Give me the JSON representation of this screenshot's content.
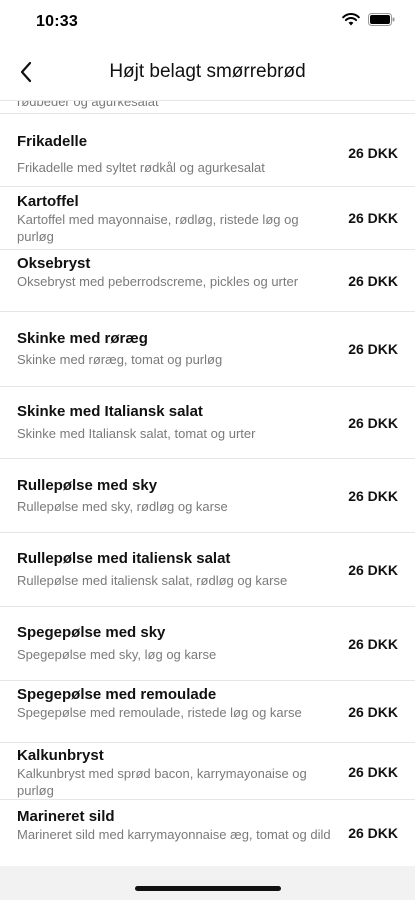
{
  "status_bar": {
    "time": "10:33"
  },
  "nav": {
    "title": "Højt belagt smørrebrød"
  },
  "list": {
    "partial_top_desc": "rødbeder og agurkesalat",
    "items": [
      {
        "name": "Frikadelle",
        "description": "Frikadelle med syltet rødkål og agurkesalat",
        "price": "26 DKK"
      },
      {
        "name": "Kartoffel",
        "description": "Kartoffel med mayonnaise, rødløg, ristede løg og purløg",
        "price": "26 DKK"
      },
      {
        "name": "Oksebryst",
        "description": "Oksebryst med peberrodscreme, pickles og urter",
        "price": "26 DKK"
      },
      {
        "name": "Skinke med røræg",
        "description": "Skinke med røræg, tomat og purløg",
        "price": "26 DKK"
      },
      {
        "name": "Skinke med Italiansk salat",
        "description": "Skinke med Italiansk salat, tomat og urter",
        "price": "26 DKK"
      },
      {
        "name": "Rullepølse med sky",
        "description": "Rullepølse med sky, rødløg og karse",
        "price": "26 DKK"
      },
      {
        "name": "Rullepølse med italiensk salat",
        "description": "Rullepølse med italiensk salat, rødløg og karse",
        "price": "26 DKK"
      },
      {
        "name": "Spegepølse med sky",
        "description": "Spegepølse med sky, løg og karse",
        "price": "26 DKK"
      },
      {
        "name": "Spegepølse med remoulade",
        "description": "Spegepølse med remoulade, ristede løg og karse",
        "price": "26 DKK"
      },
      {
        "name": "Kalkunbryst",
        "description": "Kalkunbryst med sprød bacon, karrymayonaise og purløg",
        "price": "26 DKK"
      },
      {
        "name": "Marineret sild",
        "description": "Marineret sild med karrymayonnaise æg, tomat og dild",
        "price": "26 DKK"
      }
    ]
  }
}
